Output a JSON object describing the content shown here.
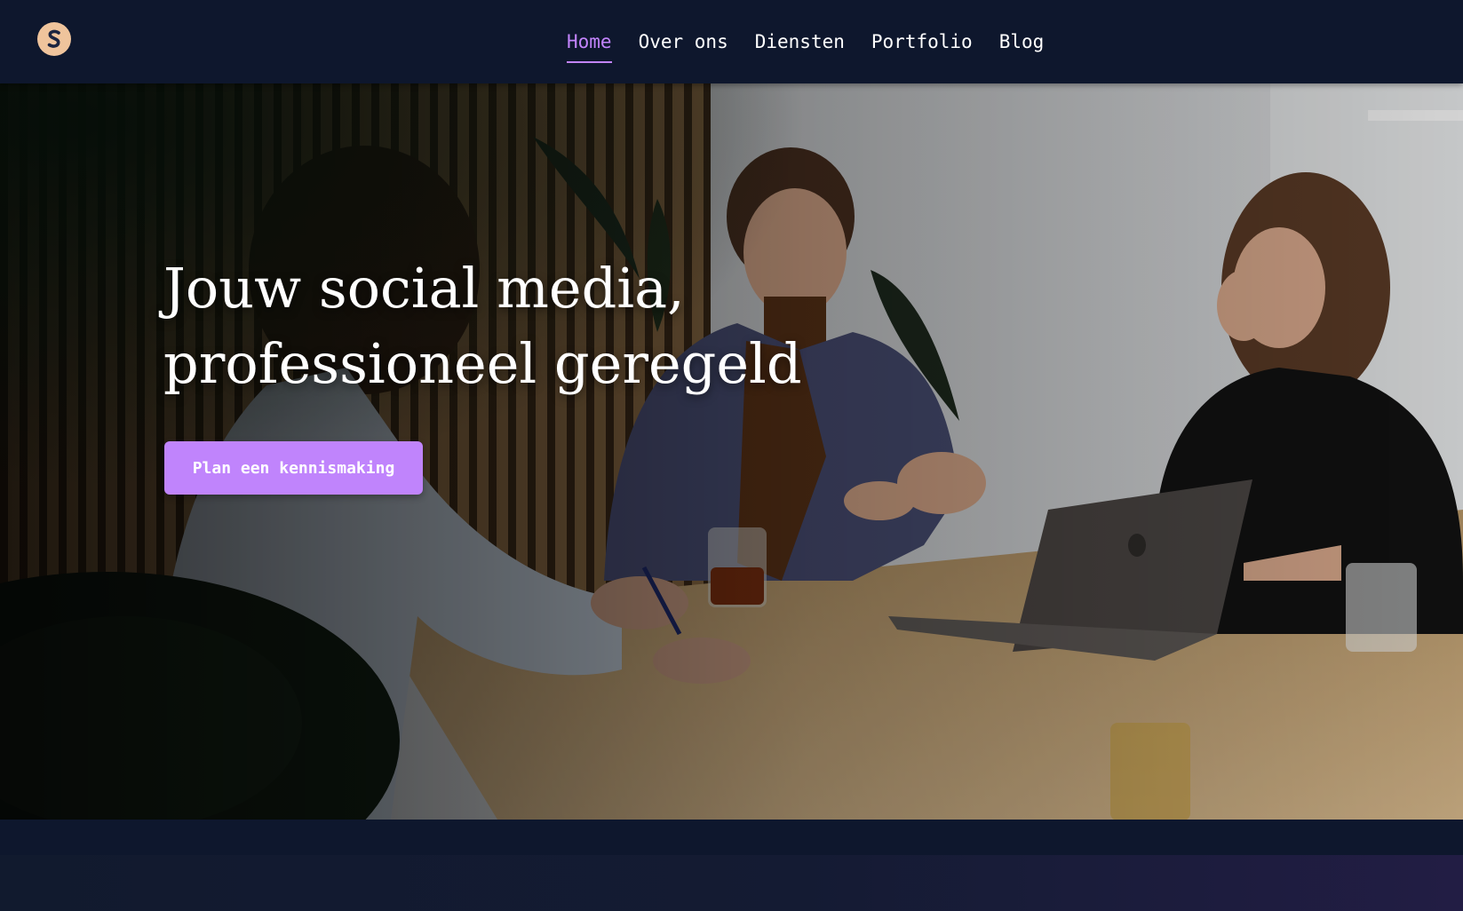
{
  "header": {
    "logo_icon": "s-monogram-logo",
    "nav": [
      {
        "label": "Home",
        "active": true
      },
      {
        "label": "Over ons",
        "active": false
      },
      {
        "label": "Diensten",
        "active": false
      },
      {
        "label": "Portfolio",
        "active": false
      },
      {
        "label": "Blog",
        "active": false
      }
    ]
  },
  "hero": {
    "title_line1": "Jouw social media,",
    "title_line2": "professioneel geregeld",
    "cta_label": "Plan een kennismaking",
    "background_icon": "meeting-photo"
  },
  "colors": {
    "navbar_bg": "#0e172d",
    "accent": "#c084fc",
    "logo_bg": "#efc49c",
    "text": "#ffffff"
  }
}
